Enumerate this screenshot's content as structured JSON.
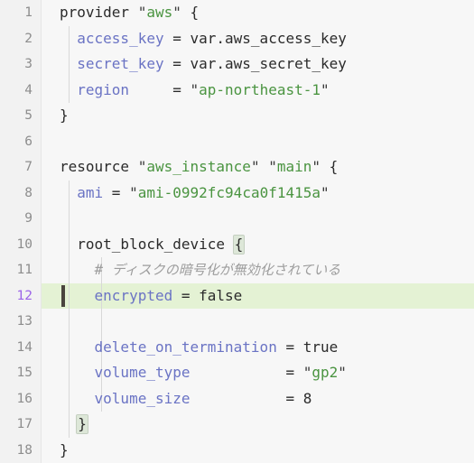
{
  "editor": {
    "language": "terraform",
    "line_count": 18,
    "active_line": 12,
    "colors": {
      "background": "#f7f7f7",
      "gutter_background": "#f2f2f2",
      "line_number": "#8d8d8d",
      "active_line_number": "#9b63e8",
      "active_line_highlight": "#e4f2d4",
      "attribute": "#6a73c4",
      "string": "#4a9440",
      "comment": "#9d9d9d",
      "plain": "#2b2b2b",
      "caret": "#4a443e",
      "indent_guide": "#d8d8d8",
      "bracket_match": "#dde7d8"
    }
  },
  "line_numbers": [
    "1",
    "2",
    "3",
    "4",
    "5",
    "6",
    "7",
    "8",
    "9",
    "10",
    "11",
    "12",
    "13",
    "14",
    "15",
    "16",
    "17",
    "18"
  ],
  "lines": [
    {
      "number": "1",
      "tokens": [
        {
          "t": "plain",
          "v": "provider "
        },
        {
          "t": "punct",
          "v": "\""
        },
        {
          "t": "str",
          "v": "aws"
        },
        {
          "t": "punct",
          "v": "\""
        },
        {
          "t": "plain",
          "v": " {"
        }
      ]
    },
    {
      "number": "2",
      "tokens": [
        {
          "t": "plain",
          "v": "  "
        },
        {
          "t": "attr",
          "v": "access_key"
        },
        {
          "t": "plain",
          "v": " = var.aws_access_key"
        }
      ]
    },
    {
      "number": "3",
      "tokens": [
        {
          "t": "plain",
          "v": "  "
        },
        {
          "t": "attr",
          "v": "secret_key"
        },
        {
          "t": "plain",
          "v": " = var.aws_secret_key"
        }
      ]
    },
    {
      "number": "4",
      "tokens": [
        {
          "t": "plain",
          "v": "  "
        },
        {
          "t": "attr",
          "v": "region"
        },
        {
          "t": "plain",
          "v": "     = "
        },
        {
          "t": "punct",
          "v": "\""
        },
        {
          "t": "str",
          "v": "ap-northeast-1"
        },
        {
          "t": "punct",
          "v": "\""
        }
      ]
    },
    {
      "number": "5",
      "tokens": [
        {
          "t": "plain",
          "v": "}"
        }
      ]
    },
    {
      "number": "6",
      "tokens": [
        {
          "t": "plain",
          "v": ""
        }
      ]
    },
    {
      "number": "7",
      "tokens": [
        {
          "t": "plain",
          "v": "resource "
        },
        {
          "t": "punct",
          "v": "\""
        },
        {
          "t": "str",
          "v": "aws_instance"
        },
        {
          "t": "punct",
          "v": "\""
        },
        {
          "t": "plain",
          "v": " "
        },
        {
          "t": "punct",
          "v": "\""
        },
        {
          "t": "str",
          "v": "main"
        },
        {
          "t": "punct",
          "v": "\""
        },
        {
          "t": "plain",
          "v": " {"
        }
      ]
    },
    {
      "number": "8",
      "tokens": [
        {
          "t": "plain",
          "v": "  "
        },
        {
          "t": "attr",
          "v": "ami"
        },
        {
          "t": "plain",
          "v": " = "
        },
        {
          "t": "punct",
          "v": "\""
        },
        {
          "t": "str",
          "v": "ami-0992fc94ca0f1415a"
        },
        {
          "t": "punct",
          "v": "\""
        }
      ]
    },
    {
      "number": "9",
      "tokens": [
        {
          "t": "plain",
          "v": ""
        }
      ]
    },
    {
      "number": "10",
      "tokens": [
        {
          "t": "plain",
          "v": "  root_block_device "
        },
        {
          "t": "bracket",
          "v": "{"
        }
      ]
    },
    {
      "number": "11",
      "tokens": [
        {
          "t": "plain",
          "v": "    "
        },
        {
          "t": "comment",
          "v": "# "
        },
        {
          "t": "comment-jp",
          "v": "ディスクの暗号化が無効化されている"
        }
      ]
    },
    {
      "number": "12",
      "tokens": [
        {
          "t": "plain",
          "v": "    "
        },
        {
          "t": "attr",
          "v": "encrypted"
        },
        {
          "t": "plain",
          "v": " = false"
        }
      ]
    },
    {
      "number": "13",
      "tokens": [
        {
          "t": "plain",
          "v": ""
        }
      ]
    },
    {
      "number": "14",
      "tokens": [
        {
          "t": "plain",
          "v": "    "
        },
        {
          "t": "attr",
          "v": "delete_on_termination"
        },
        {
          "t": "plain",
          "v": " = true"
        }
      ]
    },
    {
      "number": "15",
      "tokens": [
        {
          "t": "plain",
          "v": "    "
        },
        {
          "t": "attr",
          "v": "volume_type"
        },
        {
          "t": "plain",
          "v": "           = "
        },
        {
          "t": "punct",
          "v": "\""
        },
        {
          "t": "str",
          "v": "gp2"
        },
        {
          "t": "punct",
          "v": "\""
        }
      ]
    },
    {
      "number": "16",
      "tokens": [
        {
          "t": "plain",
          "v": "    "
        },
        {
          "t": "attr",
          "v": "volume_size"
        },
        {
          "t": "plain",
          "v": "           = 8"
        }
      ]
    },
    {
      "number": "17",
      "tokens": [
        {
          "t": "plain",
          "v": "  "
        },
        {
          "t": "bracket",
          "v": "}"
        }
      ]
    },
    {
      "number": "18",
      "tokens": [
        {
          "t": "plain",
          "v": "}"
        }
      ]
    }
  ],
  "indent_guides": [
    {
      "x": 10,
      "from_line": 2,
      "to_line": 4
    },
    {
      "x": 10,
      "from_line": 8,
      "to_line": 17
    },
    {
      "x": 46,
      "from_line": 11,
      "to_line": 16
    }
  ]
}
